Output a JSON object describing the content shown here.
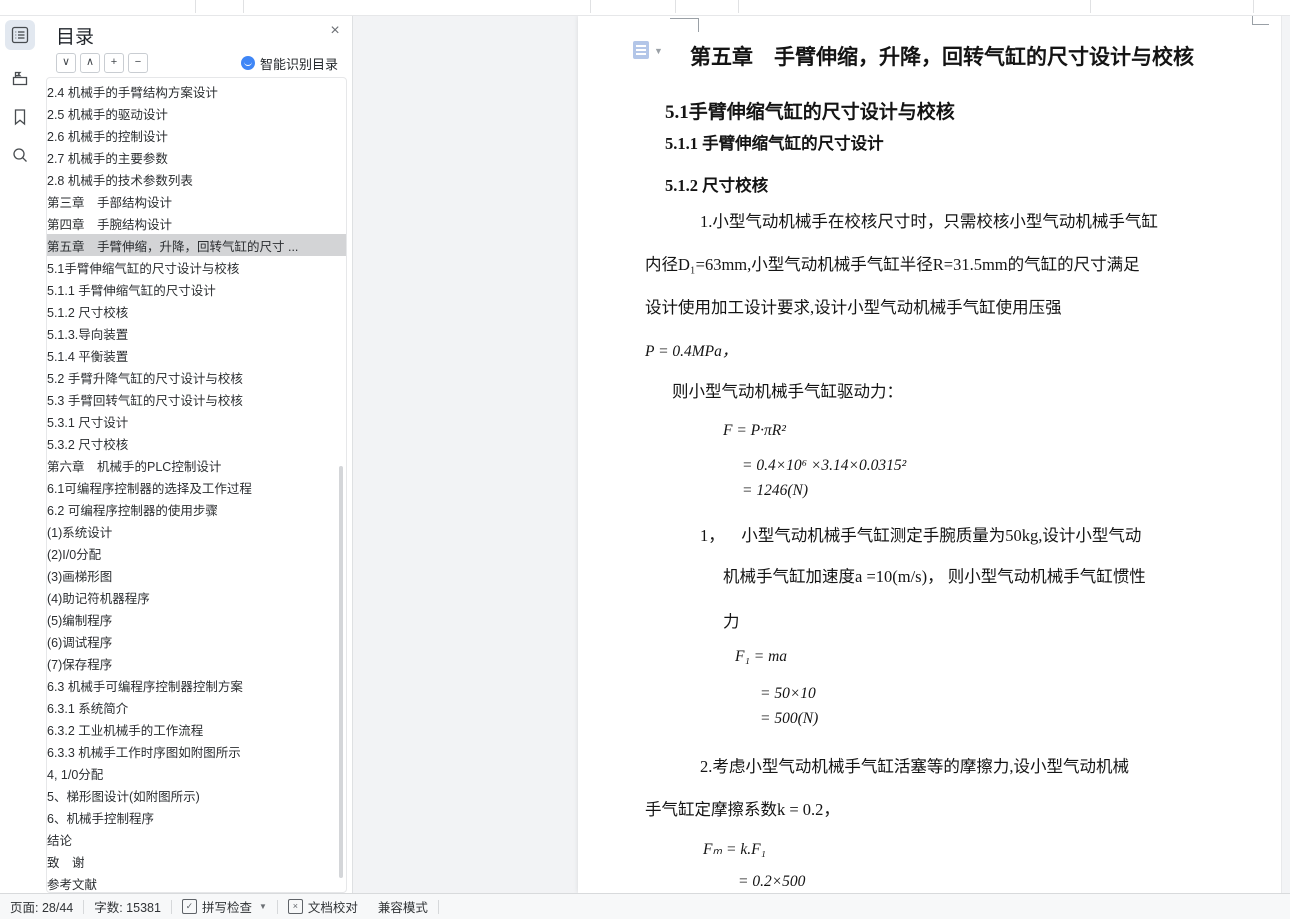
{
  "colors": {
    "accent": "#3f86f6",
    "toc_selected_bg": "#d3d4d6"
  },
  "left_toolbar": {
    "icons": [
      "catalog-icon",
      "flag-folder-icon",
      "bookmark-icon",
      "search-icon"
    ]
  },
  "toc_panel": {
    "title": "目录",
    "close_glyph": "×",
    "toolbar": {
      "collapse_all": "∨",
      "expand_all": "∧",
      "expand": "+",
      "collapse": "−"
    },
    "smart_recognize_label": "智能识别目录",
    "items": [
      {
        "label": "2.4 机械手的手臂结构方案设计",
        "level": 1
      },
      {
        "label": "2.5 机械手的驱动设计",
        "level": 1
      },
      {
        "label": "2.6 机械手的控制设计",
        "level": 1
      },
      {
        "label": "2.7 机械手的主要参数",
        "level": 1
      },
      {
        "label": "2.8 机械手的技术参数列表",
        "level": 1
      },
      {
        "label": "第三章　手部结构设计",
        "level": 0
      },
      {
        "label": "第四章　手腕结构设计",
        "level": 2
      },
      {
        "label": "第五章　手臂伸缩，升降，回转气缸的尺寸 ...",
        "level": 0,
        "chevron": true,
        "selected": true
      },
      {
        "label": "5.1手臂伸缩气缸的尺寸设计与校核",
        "level": 1,
        "chevron": true
      },
      {
        "label": "5.1.1 手臂伸缩气缸的尺寸设计",
        "level": 2
      },
      {
        "label": "5.1.2 尺寸校核",
        "level": 2
      },
      {
        "label": "5.1.3.导向装置",
        "level": 2
      },
      {
        "label": "5.1.4 平衡装置",
        "level": 2
      },
      {
        "label": "5.2 手臂升降气缸的尺寸设计与校核",
        "level": 1
      },
      {
        "label": "5.3 手臂回转气缸的尺寸设计与校核",
        "level": 1,
        "chevron": true
      },
      {
        "label": "5.3.1 尺寸设计",
        "level": 3
      },
      {
        "label": "5.3.2 尺寸校核",
        "level": 2
      },
      {
        "label": "第六章　机械手的PLC控制设计",
        "level": 0,
        "chevron": true
      },
      {
        "label": "6.1可编程序控制器的选择及工作过程",
        "level": 1
      },
      {
        "label": "6.2 可编程序控制器的使用步骤",
        "level": 1,
        "chevron": true
      },
      {
        "label": "(1)系统设计",
        "level": 2
      },
      {
        "label": "(2)I/0分配",
        "level": 2
      },
      {
        "label": "(3)画梯形图",
        "level": 2
      },
      {
        "label": "(4)助记符机器程序",
        "level": 2
      },
      {
        "label": "(5)编制程序",
        "level": 2
      },
      {
        "label": "(6)调试程序",
        "level": 2
      },
      {
        "label": "(7)保存程序",
        "level": 2
      },
      {
        "label": "6.3 机械手可编程序控制器控制方案",
        "level": 1,
        "chevron": true
      },
      {
        "label": "6.3.1 系统简介",
        "level": 2
      },
      {
        "label": "6.3.2 工业机械手的工作流程",
        "level": 2
      },
      {
        "label": "6.3.3 机械手工作时序图如附图所示",
        "level": 2
      },
      {
        "label": "4, 1/0分配",
        "level": 2
      },
      {
        "label": "5、梯形图设计(如附图所示)",
        "level": 2
      },
      {
        "label": "6、机械手控制程序",
        "level": 2
      },
      {
        "label": "结论",
        "level": 0
      },
      {
        "label": "致　谢",
        "level": 0
      },
      {
        "label": "参考文献",
        "level": 0
      }
    ]
  },
  "document": {
    "lines": [
      "第五章　手臂伸缩，升降，回转气缸的尺寸设计与校核",
      "5.1手臂伸缩气缸的尺寸设计与校核",
      "5.1.1 手臂伸缩气缸的尺寸设计",
      "5.1.2 尺寸校核",
      "1.小型气动机械手在校核尺寸时，只需校核小型气动机械手气缸",
      "内径D₁=63mm,小型气动机械手气缸半径R=31.5mm的气缸的尺寸满足",
      "设计使用加工设计要求,设计小型气动机械手气缸使用压强",
      "P = 0.4MPa，",
      "则小型气动机械手气缸驱动力：",
      "F = P·πR²",
      "= 0.4×10⁶ ×3.14×0.0315²",
      "= 1246(N)",
      "1，    小型气动机械手气缸测定手腕质量为50kg,设计小型气动",
      "机械手气缸加速度a =10(m/s)， 则小型气动机械手气缸惯性",
      "力",
      "F₁ = ma",
      "= 50×10",
      "= 500(N)",
      "2.考虑小型气动机械手气缸活塞等的摩擦力,设小型气动机械",
      "手气缸定摩擦系数k = 0.2，",
      "Fₘ = k.F₁",
      "= 0.2×500"
    ]
  },
  "status_bar": {
    "page": "页面: 28/44",
    "words": "字数: 15381",
    "spell_check": "拼写检查",
    "doc_proof": "文档校对",
    "compat_mode": "兼容模式"
  }
}
